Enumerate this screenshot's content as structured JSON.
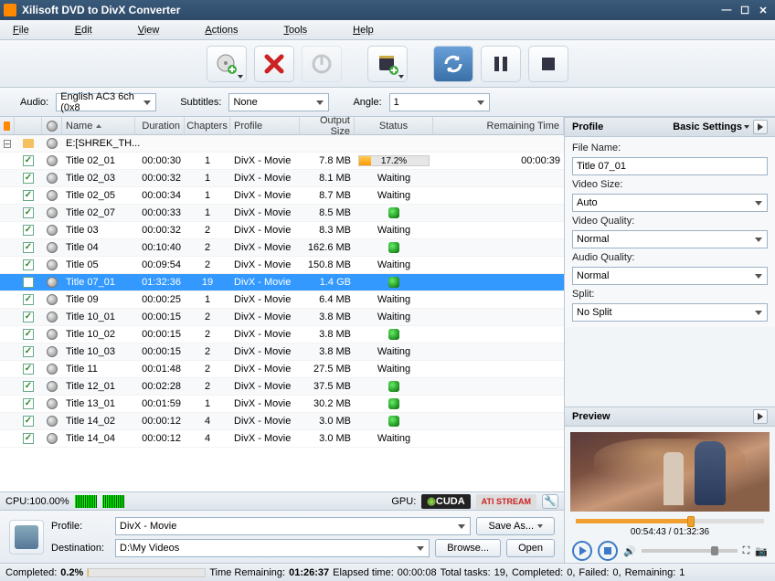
{
  "window": {
    "title": "Xilisoft DVD to DivX Converter"
  },
  "menu": [
    "File",
    "Edit",
    "View",
    "Actions",
    "Tools",
    "Help"
  ],
  "options": {
    "audio_label": "Audio:",
    "audio_value": "English AC3 6ch (0x8",
    "subtitles_label": "Subtitles:",
    "subtitles_value": "None",
    "angle_label": "Angle:",
    "angle_value": "1"
  },
  "columns": [
    "",
    "",
    "",
    "Name",
    "Duration",
    "Chapters",
    "Profile",
    "Output Size",
    "Status",
    "Remaining Time"
  ],
  "group": {
    "name": "E:[SHREK_TH..."
  },
  "rows": [
    {
      "chk": true,
      "name": "Title 02_01",
      "dur": "00:00:30",
      "ch": "1",
      "prof": "DivX - Movie",
      "size": "7.8 MB",
      "status": "progress",
      "pct": "17.2%",
      "pctw": 17.2,
      "rem": "00:00:39"
    },
    {
      "chk": true,
      "name": "Title 02_03",
      "dur": "00:00:32",
      "ch": "1",
      "prof": "DivX - Movie",
      "size": "8.1 MB",
      "status": "Waiting",
      "rem": ""
    },
    {
      "chk": true,
      "name": "Title 02_05",
      "dur": "00:00:34",
      "ch": "1",
      "prof": "DivX - Movie",
      "size": "8.7 MB",
      "status": "Waiting",
      "rem": ""
    },
    {
      "chk": true,
      "name": "Title 02_07",
      "dur": "00:00:33",
      "ch": "1",
      "prof": "DivX - Movie",
      "size": "8.5 MB",
      "status": "dot",
      "rem": ""
    },
    {
      "chk": true,
      "name": "Title 03",
      "dur": "00:00:32",
      "ch": "2",
      "prof": "DivX - Movie",
      "size": "8.3 MB",
      "status": "Waiting",
      "rem": ""
    },
    {
      "chk": true,
      "name": "Title 04",
      "dur": "00:10:40",
      "ch": "2",
      "prof": "DivX - Movie",
      "size": "162.6 MB",
      "status": "dot",
      "rem": ""
    },
    {
      "chk": true,
      "name": "Title 05",
      "dur": "00:09:54",
      "ch": "2",
      "prof": "DivX - Movie",
      "size": "150.8 MB",
      "status": "Waiting",
      "rem": ""
    },
    {
      "chk": false,
      "sel": true,
      "name": "Title 07_01",
      "dur": "01:32:36",
      "ch": "19",
      "prof": "DivX - Movie",
      "size": "1.4 GB",
      "status": "dot",
      "rem": ""
    },
    {
      "chk": true,
      "name": "Title 09",
      "dur": "00:00:25",
      "ch": "1",
      "prof": "DivX - Movie",
      "size": "6.4 MB",
      "status": "Waiting",
      "rem": ""
    },
    {
      "chk": true,
      "name": "Title 10_01",
      "dur": "00:00:15",
      "ch": "2",
      "prof": "DivX - Movie",
      "size": "3.8 MB",
      "status": "Waiting",
      "rem": ""
    },
    {
      "chk": true,
      "name": "Title 10_02",
      "dur": "00:00:15",
      "ch": "2",
      "prof": "DivX - Movie",
      "size": "3.8 MB",
      "status": "dot",
      "rem": ""
    },
    {
      "chk": true,
      "name": "Title 10_03",
      "dur": "00:00:15",
      "ch": "2",
      "prof": "DivX - Movie",
      "size": "3.8 MB",
      "status": "Waiting",
      "rem": ""
    },
    {
      "chk": true,
      "name": "Title 11",
      "dur": "00:01:48",
      "ch": "2",
      "prof": "DivX - Movie",
      "size": "27.5 MB",
      "status": "Waiting",
      "rem": ""
    },
    {
      "chk": true,
      "name": "Title 12_01",
      "dur": "00:02:28",
      "ch": "2",
      "prof": "DivX - Movie",
      "size": "37.5 MB",
      "status": "dot",
      "rem": ""
    },
    {
      "chk": true,
      "name": "Title 13_01",
      "dur": "00:01:59",
      "ch": "1",
      "prof": "DivX - Movie",
      "size": "30.2 MB",
      "status": "dot",
      "rem": ""
    },
    {
      "chk": true,
      "name": "Title 14_02",
      "dur": "00:00:12",
      "ch": "4",
      "prof": "DivX - Movie",
      "size": "3.0 MB",
      "status": "dot",
      "rem": ""
    },
    {
      "chk": true,
      "name": "Title 14_04",
      "dur": "00:00:12",
      "ch": "4",
      "prof": "DivX - Movie",
      "size": "3.0 MB",
      "status": "Waiting",
      "rem": ""
    }
  ],
  "cpu": {
    "label": "CPU:100.00%",
    "gpu_label": "GPU:",
    "cuda": "CUDA",
    "ati": "ATI STREAM"
  },
  "profile_row": {
    "profile_label": "Profile:",
    "profile_value": "DivX - Movie",
    "dest_label": "Destination:",
    "dest_value": "D:\\My Videos",
    "saveas": "Save As...",
    "browse": "Browse...",
    "open": "Open"
  },
  "statusbar": {
    "completed_label": "Completed:",
    "completed": "0.2%",
    "time_remaining_label": "Time Remaining:",
    "time_remaining": "01:26:37",
    "elapsed_label": "Elapsed time:",
    "elapsed": "00:00:08",
    "total_label": "Total tasks:",
    "total": "19,",
    "completed_tasks_label": "Completed:",
    "completed_tasks": "0,",
    "failed_label": "Failed:",
    "failed": "0,",
    "remaining_label": "Remaining:",
    "remaining": "1"
  },
  "profile_panel": {
    "title": "Profile",
    "settings": "Basic Settings",
    "filename_label": "File Name:",
    "filename": "Title 07_01",
    "videosize_label": "Video Size:",
    "videosize": "Auto",
    "videoquality_label": "Video Quality:",
    "videoquality": "Normal",
    "audioquality_label": "Audio Quality:",
    "audioquality": "Normal",
    "split_label": "Split:",
    "split": "No Split"
  },
  "preview": {
    "title": "Preview",
    "time": "00:54:43 / 01:32:36"
  }
}
